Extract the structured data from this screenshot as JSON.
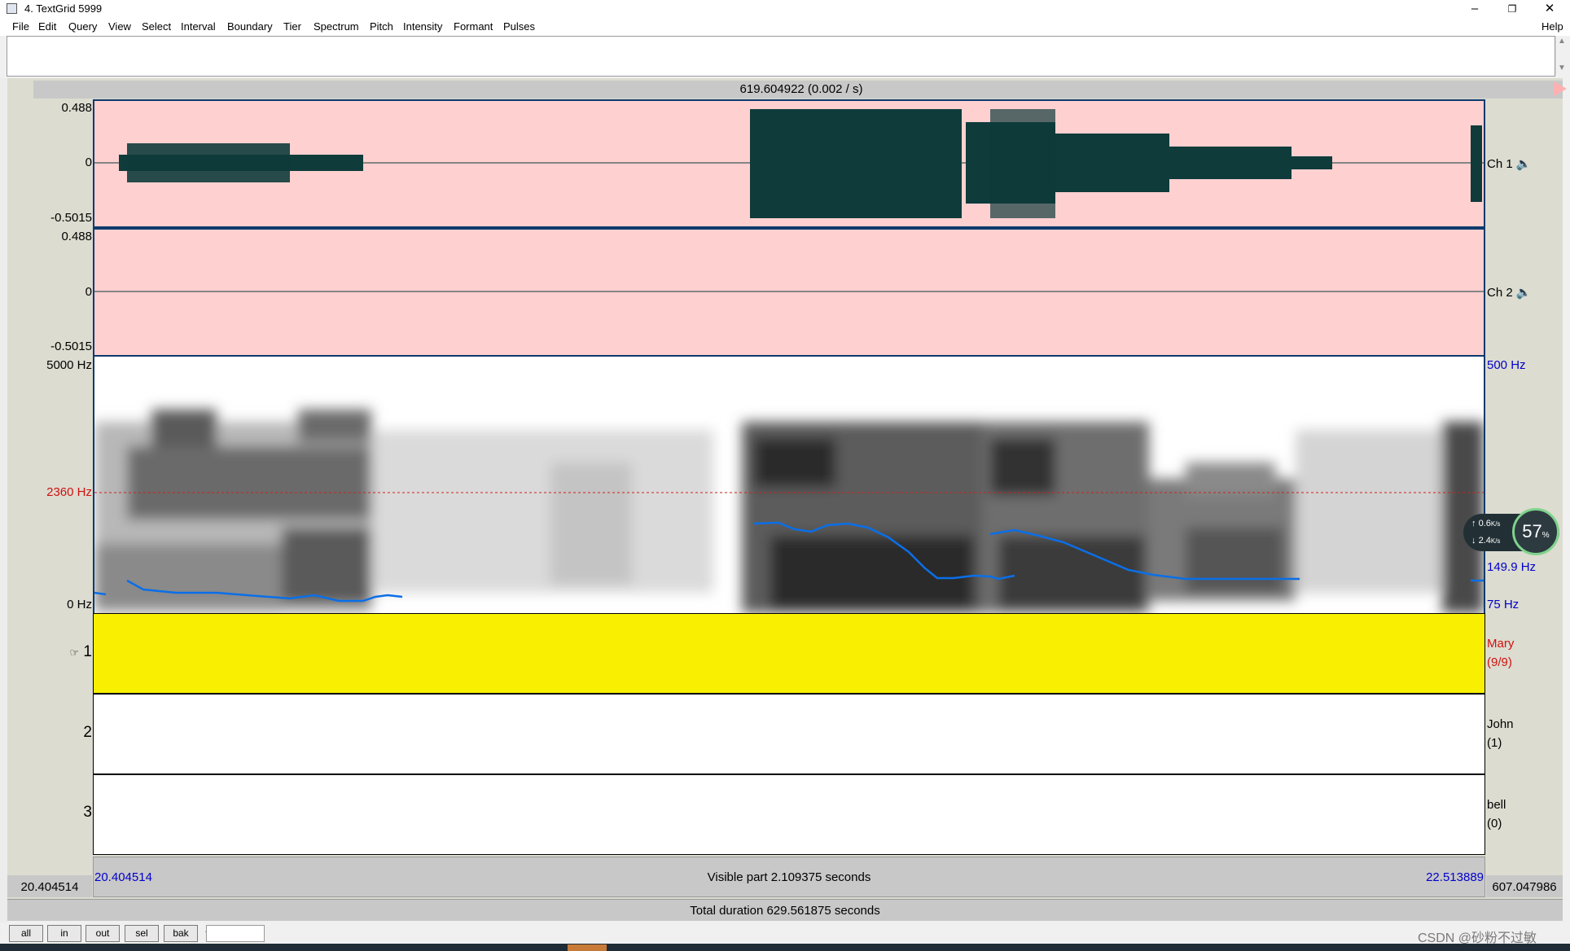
{
  "window": {
    "title": "4. TextGrid 5999",
    "min": "–",
    "max": "❐",
    "close": "✕"
  },
  "menu": [
    "File",
    "Edit",
    "Query",
    "View",
    "Select",
    "Interval",
    "Boundary",
    "Tier",
    "Spectrum",
    "Pitch",
    "Intensity",
    "Formant",
    "Pulses"
  ],
  "help": "Help",
  "cursor_time": "619.604922 (0.002 / s)",
  "channel1": {
    "max": "0.488",
    "zero": "0",
    "min": "-0.5015",
    "label": "Ch 1"
  },
  "channel2": {
    "max": "0.488",
    "zero": "0",
    "min": "-0.5015",
    "label": "Ch 2"
  },
  "spectrogram": {
    "top": "5000 Hz",
    "cursor": "2360 Hz",
    "bottom": "0 Hz",
    "pitch_top": "500 Hz",
    "pitch_value": "149.9 Hz",
    "pitch_bottom": "75 Hz"
  },
  "tiers": [
    {
      "number": "1",
      "name": "Mary",
      "count": "(9/9)"
    },
    {
      "number": "2",
      "name": "John",
      "count": "(1)"
    },
    {
      "number": "3",
      "name": "bell",
      "count": "(0)"
    }
  ],
  "window_start": "20.404514",
  "window_end": "22.513889",
  "visible_part": "Visible part 2.109375 seconds",
  "left_time": "20.404514",
  "right_time": "607.047986",
  "total_duration": "Total duration 629.561875 seconds",
  "nav_buttons": [
    "all",
    "in",
    "out",
    "sel",
    "bak"
  ],
  "net_widget": {
    "up": "0.6",
    "down": "2.4",
    "unit": "K/s",
    "cpu": "57",
    "cpu_unit": "%"
  },
  "watermark": "CSDN @砂粉不过敏",
  "colors": {
    "waveform_bg": "#ffd0d0",
    "tier_selected": "#f8f000",
    "pitch": "#0a6fe8",
    "frame": "#0d3a6e"
  }
}
